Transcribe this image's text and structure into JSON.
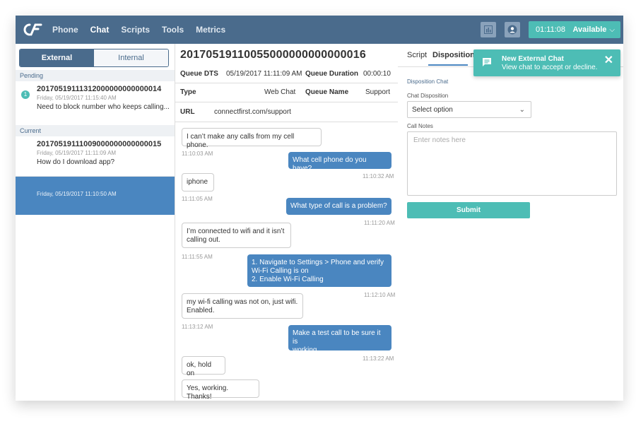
{
  "nav": {
    "items": [
      "Phone",
      "Chat",
      "Scripts",
      "Tools",
      "Metrics"
    ],
    "active": "Chat",
    "timer": "01:11:08",
    "status": "Available"
  },
  "left": {
    "tabs": {
      "external": "External",
      "internal": "Internal"
    },
    "pending_label": "Pending",
    "current_label": "Current",
    "pending": [
      {
        "badge": "1",
        "id": "20170519111312000000000000014",
        "date": "Friday, 05/19/2017 11:15:40 AM",
        "message": "Need to block number who keeps calling..."
      }
    ],
    "current": [
      {
        "id": "20170519111009000000000000015",
        "date": "Friday, 05/19/2017 11:11:09 AM",
        "message": "How do I download app?"
      },
      {
        "date": "Friday, 05/19/2017 11:10:50 AM"
      }
    ]
  },
  "detail": {
    "title": "20170519110055000000000000016",
    "queue_dts_label": "Queue DTS",
    "queue_dts": "05/19/2017 11:11:09 AM",
    "queue_duration_label": "Queue Duration",
    "queue_duration": "00:00:10",
    "type_label": "Type",
    "type": "Web Chat",
    "queue_name_label": "Queue Name",
    "queue_name": "Support",
    "url_label": "URL",
    "url": "connectfirst.com/support"
  },
  "messages": [
    {
      "dir": "in",
      "text": "I can’t make any calls from my cell phone.",
      "time": "11:10:03 AM"
    },
    {
      "dir": "out",
      "text": "What cell phone do you have?",
      "time": "11:10:32 AM"
    },
    {
      "dir": "in",
      "text": "iphone",
      "time": "11:11:05 AM"
    },
    {
      "dir": "out",
      "text": "What type of call is a problem?",
      "time": "11:11:20 AM"
    },
    {
      "dir": "in",
      "lines": [
        "I’m connected to wifi and it isn’t",
        "calling out."
      ],
      "time": "11:11:55 AM"
    },
    {
      "dir": "out",
      "lines": [
        "1. Navigate to Settings > Phone and verify",
        "Wi-Fi Calling is on",
        "2. Enable Wi-Fi Calling"
      ],
      "time": "11:12:10 AM"
    },
    {
      "dir": "in",
      "lines": [
        "my wi-fi calling was not on, just wifi.",
        "Enabled."
      ],
      "time": "11:13:12 AM"
    },
    {
      "dir": "out",
      "lines": [
        "Make a test call to be sure it is",
        "working."
      ],
      "time": "11:13:22 AM"
    },
    {
      "dir": "in",
      "text": "ok, hold on"
    },
    {
      "dir": "in",
      "text": "Yes, working. Thanks!"
    }
  ],
  "right": {
    "tabs": [
      "Script",
      "Disposition"
    ],
    "active_tab": "Disposition",
    "section_title": "Disposition Chat",
    "chat_disposition_label": "Chat Disposition",
    "select_value": "Select option",
    "call_notes_label": "Call Notes",
    "notes_placeholder": "Enter notes here",
    "submit_label": "Submit"
  },
  "toast": {
    "title": "New External Chat",
    "subtitle": "View chat to accept or decline."
  },
  "colors": {
    "nav": "#4a6b8c",
    "accent_teal": "#4dbdb5",
    "outgoing_bubble": "#4a86c0"
  },
  "icons": [
    "logo-icon",
    "metrics-icon",
    "user-icon",
    "chevron-down-icon",
    "chat-bubble-icon",
    "close-icon"
  ]
}
